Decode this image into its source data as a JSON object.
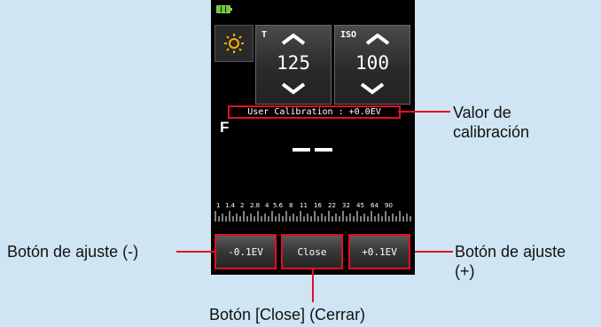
{
  "device": {
    "readings": {
      "t_label": "T",
      "t_value": "125",
      "iso_label": "ISO",
      "iso_value": "100",
      "calibration_text": "User Calibration : +0.0EV",
      "f_label": "F"
    },
    "scale_labels": [
      "1",
      "1.4",
      "2",
      "2.8",
      "4",
      "5.6",
      "8",
      "11",
      "16",
      "22",
      "32",
      "45",
      "64",
      "90"
    ],
    "buttons": {
      "minus": "-0.1EV",
      "close": "Close",
      "plus": "+0.1EV"
    },
    "icons": {
      "sun": "sun-icon",
      "battery": "battery-icon"
    },
    "colors": {
      "highlight": "#e01020",
      "accent_sun": "#ffb000",
      "background": "#cfe5f3"
    }
  },
  "callouts": {
    "calibration_line1": "Valor de",
    "calibration_line2": "calibración",
    "minus_button": "Botón de ajuste (-)",
    "plus_line1": "Botón de ajuste",
    "plus_line2": "(+)",
    "close_button": "Botón [Close] (Cerrar)"
  }
}
